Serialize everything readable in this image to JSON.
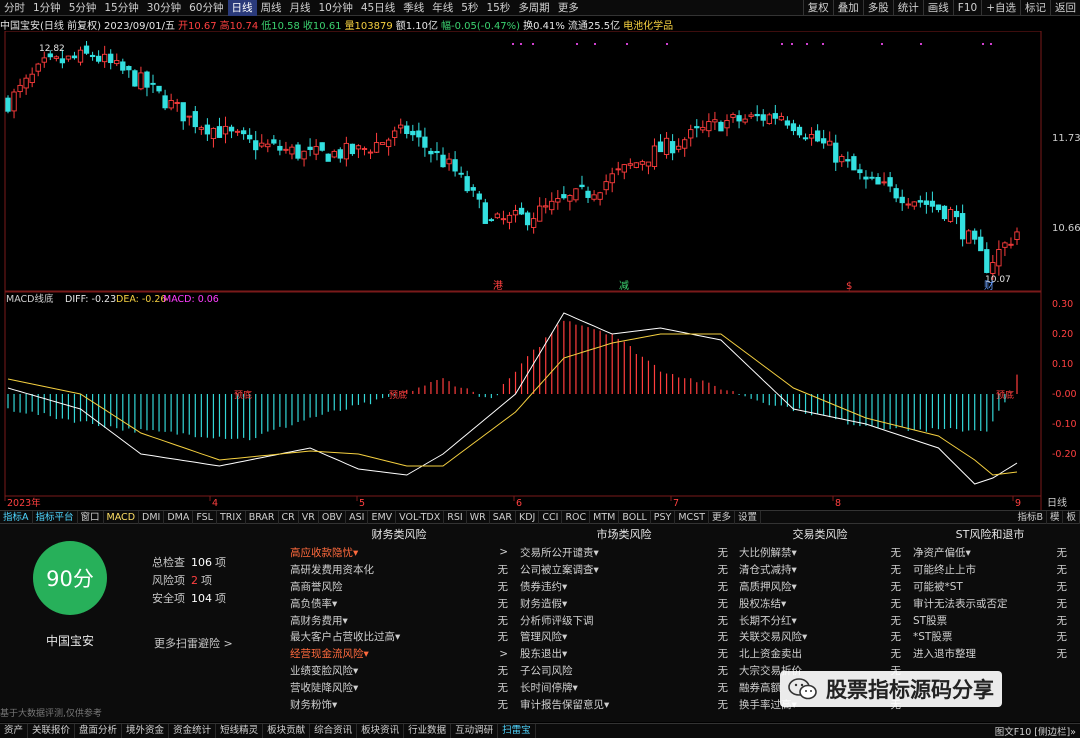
{
  "periods": [
    "分时",
    "1分钟",
    "5分钟",
    "15分钟",
    "30分钟",
    "60分钟",
    "日线",
    "周线",
    "月线",
    "10分钟",
    "45日线",
    "季线",
    "年线",
    "5秒",
    "15秒",
    "多周期",
    "更多"
  ],
  "period_active": "日线",
  "toolbar_right": [
    "复权",
    "叠加",
    "多股",
    "统计",
    "画线",
    "F10",
    "+自选",
    "标记",
    "返回"
  ],
  "info": {
    "stock_title": "中国宝安(日线 前复权)",
    "date": "2023/09/01/五",
    "open": "开10.67",
    "high": "高10.74",
    "low": "低10.58",
    "close": "收10.61",
    "volume": "量103879",
    "amount": "额1.10亿",
    "change": "幅-0.05(-0.47%)",
    "turnover": "换0.41%",
    "float_cap": "流通25.5亿",
    "sector": "电池化学品"
  },
  "price_chart": {
    "right_labels": [
      "11.73",
      "10.66"
    ],
    "high_label": "12.82",
    "low_label": "10.07",
    "markers": [
      {
        "text": "港",
        "color": "#ff4040"
      },
      {
        "text": "减",
        "color": "#3bd16f"
      },
      {
        "text": "$",
        "color": "#ff4040"
      },
      {
        "text": "财",
        "color": "#6aa0ff"
      }
    ]
  },
  "macd": {
    "title": "MACD线底",
    "diff_label": "DIFF: -0.23",
    "dea_label": "DEA: -0.26",
    "macd_label": "MACD: 0.06",
    "axis_labels": [
      "0.30",
      "0.20",
      "0.10",
      "-0.00",
      "-0.10",
      "-0.20"
    ],
    "signal_text": "预底",
    "colors": {
      "up": "#ff3d3d",
      "down": "#33d6d6",
      "diff": "#ffffff",
      "dea": "#f5d040"
    }
  },
  "x_axis": {
    "labels": [
      "2023年",
      "4",
      "5",
      "6",
      "7",
      "8",
      "9"
    ],
    "right_label": "日线"
  },
  "indicator_tabs": [
    "指标A",
    "指标平台",
    "窗口",
    "MACD",
    "DMI",
    "DMA",
    "FSL",
    "TRIX",
    "BRAR",
    "CR",
    "VR",
    "OBV",
    "ASI",
    "EMV",
    "VOL-TDX",
    "RSI",
    "WR",
    "SAR",
    "KDJ",
    "CCI",
    "ROC",
    "MTM",
    "BOLL",
    "PSY",
    "MCST",
    "更多",
    "设置"
  ],
  "indicator_right": [
    "指标B",
    "模",
    "板"
  ],
  "risk": {
    "score": "90分",
    "stock_name": "中国宝安",
    "total_label": "总检查",
    "total_value": "106",
    "risk_label": "风险项",
    "risk_value": "2",
    "safe_label": "安全项",
    "safe_value": "104",
    "unit": "项",
    "more_scan": "更多扫雷避险 >",
    "disclaimer": "基于大数据评测,仅供参考",
    "columns": [
      {
        "title": "财务类风险",
        "items": [
          {
            "label": "高应收款隐忧▾",
            "value": ">",
            "orange": true
          },
          {
            "label": "高研发费用资本化",
            "value": "无"
          },
          {
            "label": "高商誉风险",
            "value": "无"
          },
          {
            "label": "高负债率▾",
            "value": "无"
          },
          {
            "label": "高财务费用▾",
            "value": "无"
          },
          {
            "label": "最大客户占营收比过高▾",
            "value": "无"
          },
          {
            "label": "经营现金流风险▾",
            "value": ">",
            "orange": true
          },
          {
            "label": "业绩变脸风险▾",
            "value": "无"
          },
          {
            "label": "营收陡降风险▾",
            "value": "无"
          },
          {
            "label": "财务粉饰▾",
            "value": "无"
          }
        ]
      },
      {
        "title": "市场类风险",
        "items": [
          {
            "label": "交易所公开谴责▾",
            "value": "无"
          },
          {
            "label": "公司被立案调查▾",
            "value": "无"
          },
          {
            "label": "债券违约▾",
            "value": "无"
          },
          {
            "label": "财务造假▾",
            "value": "无"
          },
          {
            "label": "分析师评级下调",
            "value": "无"
          },
          {
            "label": "管理风险▾",
            "value": "无"
          },
          {
            "label": "股东退出▾",
            "value": "无"
          },
          {
            "label": "子公司风险",
            "value": "无"
          },
          {
            "label": "长时间停牌▾",
            "value": "无"
          },
          {
            "label": "审计报告保留意见▾",
            "value": "无"
          }
        ]
      },
      {
        "title": "交易类风险",
        "items": [
          {
            "label": "大比例解禁▾",
            "value": "无"
          },
          {
            "label": "清仓式减持▾",
            "value": "无"
          },
          {
            "label": "高质押风险▾",
            "value": "无"
          },
          {
            "label": "股权冻结▾",
            "value": "无"
          },
          {
            "label": "长期不分红▾",
            "value": "无"
          },
          {
            "label": "关联交易风险▾",
            "value": "无"
          },
          {
            "label": "北上资金卖出",
            "value": "无"
          },
          {
            "label": "大宗交易折价",
            "value": "无"
          },
          {
            "label": "融券高额",
            "value": "无"
          },
          {
            "label": "换手率过高▾",
            "value": "无"
          }
        ]
      },
      {
        "title": "ST风险和退市",
        "items": [
          {
            "label": "净资产偏低▾",
            "value": "无"
          },
          {
            "label": "可能终止上市",
            "value": "无"
          },
          {
            "label": "可能被*ST",
            "value": "无"
          },
          {
            "label": "审计无法表示或否定",
            "value": "无"
          },
          {
            "label": "ST股票",
            "value": "无"
          },
          {
            "label": "*ST股票",
            "value": "无"
          },
          {
            "label": "进入退市整理",
            "value": "无"
          }
        ]
      }
    ]
  },
  "bottom_tabs": [
    "资产",
    "关联报价",
    "盘面分析",
    "境外资金",
    "资金统计",
    "短线精灵",
    "板块贡献",
    "综合资讯",
    "板块资讯",
    "行业数据",
    "互动调研",
    "扫雷宝"
  ],
  "bottom_active": "扫雷宝",
  "bottom_right": "图文F10 [侧边栏]»",
  "watermark": "股票指标源码分享"
}
